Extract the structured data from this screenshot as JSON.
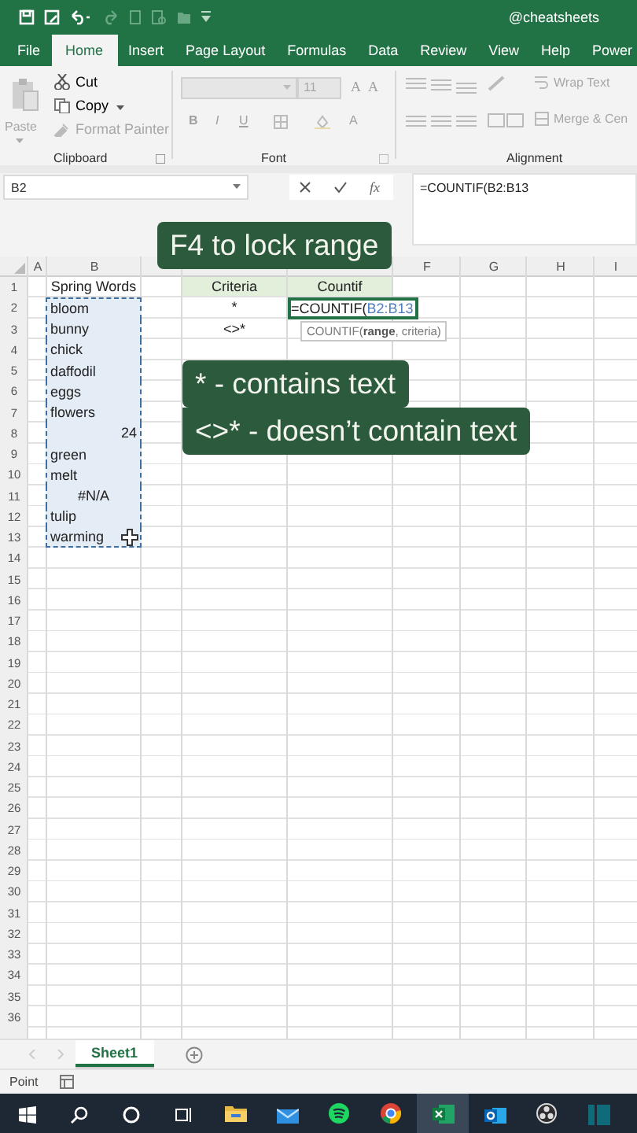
{
  "title_bar": {
    "account": "@cheatsheets"
  },
  "ribbon_tabs": [
    {
      "label": "File",
      "selected": false
    },
    {
      "label": "Home",
      "selected": true
    },
    {
      "label": "Insert",
      "selected": false
    },
    {
      "label": "Page Layout",
      "selected": false
    },
    {
      "label": "Formulas",
      "selected": false
    },
    {
      "label": "Data",
      "selected": false
    },
    {
      "label": "Review",
      "selected": false
    },
    {
      "label": "View",
      "selected": false
    },
    {
      "label": "Help",
      "selected": false
    },
    {
      "label": "Power",
      "selected": false
    }
  ],
  "ribbon": {
    "clipboard": {
      "paste": "Paste",
      "cut": "Cut",
      "copy": "Copy",
      "format_painter": "Format Painter",
      "label": "Clipboard"
    },
    "font": {
      "size": "11",
      "grow": "A",
      "shrink": "A",
      "bold": "B",
      "italic": "I",
      "underline": "U",
      "font_color": "A",
      "label": "Font"
    },
    "alignment": {
      "wrap_text": "Wrap Text",
      "merge": "Merge & Cen",
      "label": "Alignment"
    }
  },
  "formula_bar": {
    "name_box": "B2",
    "function_label": "fx",
    "formula": "=COUNTIF(B2:B13"
  },
  "column_headers": {
    "A": "A",
    "B": "B",
    "F": "F",
    "G": "G",
    "H": "H",
    "I": "I"
  },
  "rows": [
    {
      "number": "1",
      "cells": {
        "B": {
          "kind": "heading",
          "text": "Spring Words",
          "highlighted": false,
          "active": false
        },
        "D": {
          "kind": "header",
          "text": "Criteria",
          "highlighted": false,
          "active": false
        },
        "E": {
          "kind": "header",
          "text": "Countif",
          "highlighted": false,
          "active": false
        }
      }
    },
    {
      "number": "2",
      "cells": {
        "B": {
          "kind": "text",
          "text": "bloom",
          "highlighted": true,
          "active": false
        },
        "D": {
          "kind": "symbol",
          "text": "*",
          "highlighted": false,
          "active": false
        },
        "E": {
          "kind": "formula",
          "prefix": "=COUNTIF(",
          "range": "B2:B13",
          "highlighted": false,
          "active": true
        }
      }
    },
    {
      "number": "3",
      "cells": {
        "B": {
          "kind": "text",
          "text": "bunny",
          "highlighted": true,
          "active": false
        },
        "D": {
          "kind": "symbol",
          "text": "<>*",
          "highlighted": false,
          "active": false
        }
      }
    },
    {
      "number": "4",
      "cells": {
        "B": {
          "kind": "text",
          "text": "chick",
          "highlighted": true,
          "active": false
        }
      }
    },
    {
      "number": "5",
      "cells": {
        "B": {
          "kind": "text",
          "text": "daffodil",
          "highlighted": true,
          "active": false
        }
      }
    },
    {
      "number": "6",
      "cells": {
        "B": {
          "kind": "text",
          "text": "eggs",
          "highlighted": true,
          "active": false
        }
      }
    },
    {
      "number": "7",
      "cells": {
        "B": {
          "kind": "text",
          "text": "flowers",
          "highlighted": true,
          "active": false
        }
      }
    },
    {
      "number": "8",
      "cells": {
        "B": {
          "kind": "number",
          "text": "24",
          "highlighted": true,
          "active": false
        }
      }
    },
    {
      "number": "9",
      "cells": {
        "B": {
          "kind": "text",
          "text": "green",
          "highlighted": true,
          "active": false
        }
      }
    },
    {
      "number": "10",
      "cells": {
        "B": {
          "kind": "text",
          "text": "melt",
          "highlighted": true,
          "active": false
        }
      }
    },
    {
      "number": "11",
      "cells": {
        "B": {
          "kind": "error",
          "text": "#N/A",
          "highlighted": true,
          "active": false
        }
      }
    },
    {
      "number": "12",
      "cells": {
        "B": {
          "kind": "text",
          "text": "tulip",
          "highlighted": true,
          "active": false
        }
      }
    },
    {
      "number": "13",
      "cells": {
        "B": {
          "kind": "text",
          "text": "warming",
          "highlighted": true,
          "active": false
        }
      }
    },
    {
      "number": "14"
    },
    {
      "number": "15"
    },
    {
      "number": "16"
    },
    {
      "number": "17"
    },
    {
      "number": "18"
    },
    {
      "number": "19"
    },
    {
      "number": "20"
    },
    {
      "number": "21"
    },
    {
      "number": "22"
    },
    {
      "number": "23"
    },
    {
      "number": "24"
    },
    {
      "number": "25"
    },
    {
      "number": "26"
    },
    {
      "number": "27"
    },
    {
      "number": "28"
    },
    {
      "number": "29"
    },
    {
      "number": "30"
    },
    {
      "number": "31"
    },
    {
      "number": "32"
    },
    {
      "number": "33"
    },
    {
      "number": "34"
    },
    {
      "number": "35"
    },
    {
      "number": "36"
    }
  ],
  "formula_tooltip": "COUNTIF(**range**, criteria)",
  "captions": [
    {
      "lines": [
        "F4 to lock range"
      ]
    },
    {
      "lines": [
        "* - contains text",
        "<>* - doesn’t contain text"
      ]
    }
  ],
  "sheet_tabs": [
    {
      "label": "Sheet1",
      "selected": true
    }
  ],
  "status_bar": {
    "mode": "Point"
  },
  "taskbar": [
    {
      "kind": "start",
      "running": false,
      "selected": false
    },
    {
      "kind": "search",
      "running": false,
      "selected": false
    },
    {
      "kind": "cortana",
      "running": false,
      "selected": false
    },
    {
      "kind": "taskview",
      "running": false,
      "selected": false
    },
    {
      "kind": "explorer",
      "running": true,
      "selected": false
    },
    {
      "kind": "mail",
      "running": false,
      "selected": false
    },
    {
      "kind": "spotify",
      "running": true,
      "selected": false
    },
    {
      "kind": "chrome",
      "running": true,
      "selected": false
    },
    {
      "kind": "excel",
      "running": true,
      "selected": true
    },
    {
      "kind": "outlook",
      "running": false,
      "selected": false
    },
    {
      "kind": "obs",
      "running": true,
      "selected": false
    },
    {
      "kind": "panel",
      "running": false,
      "selected": false
    }
  ]
}
